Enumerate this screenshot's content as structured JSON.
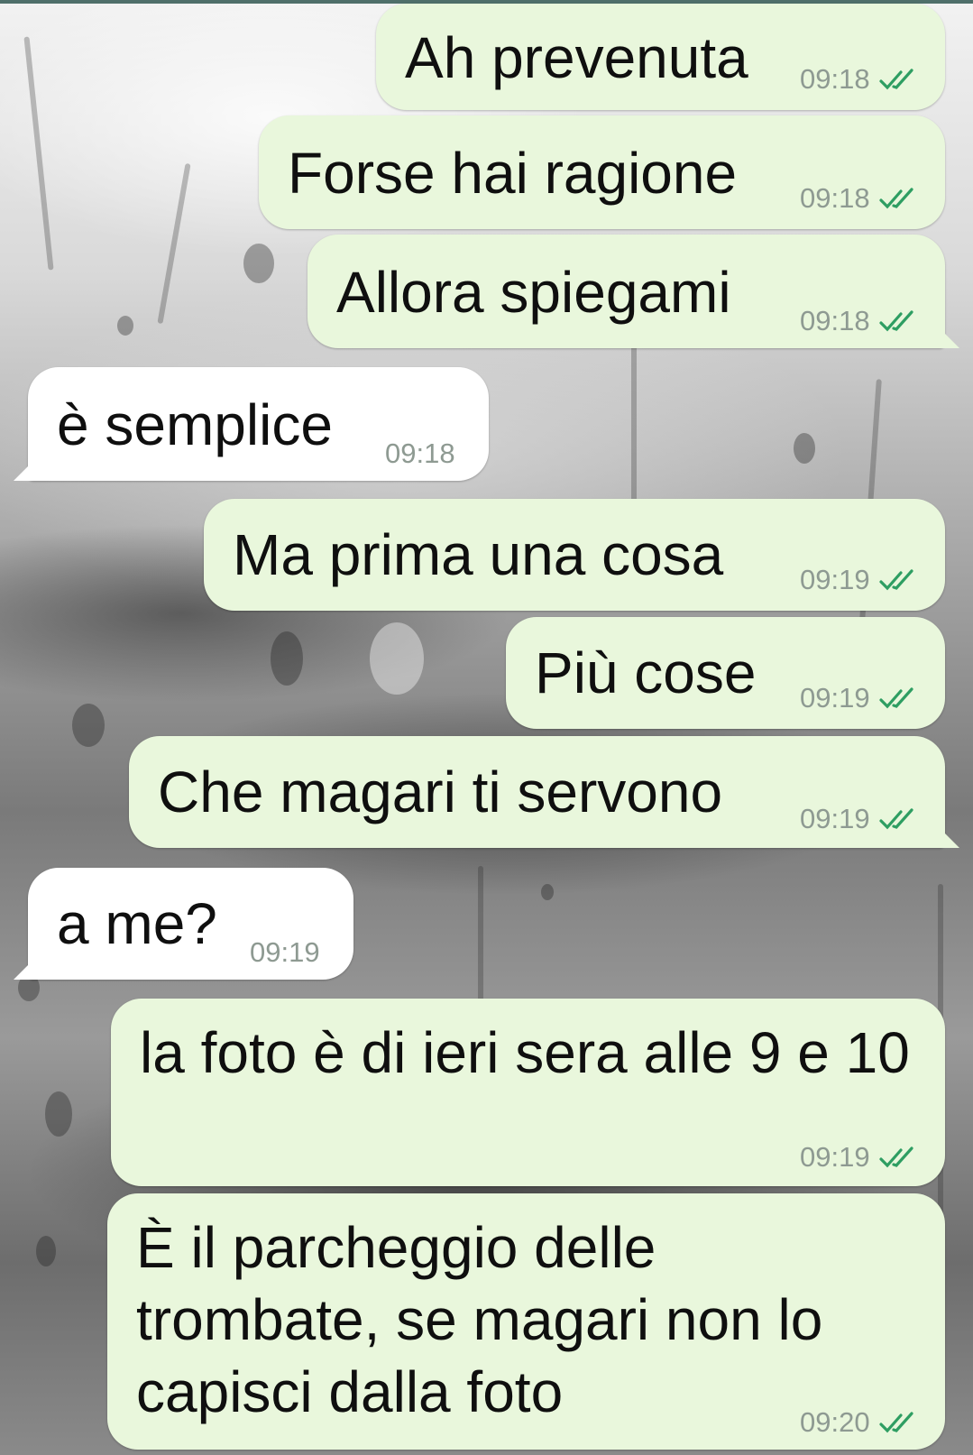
{
  "colors": {
    "outgoing_bubble": "#e9f7dc",
    "incoming_bubble": "#ffffff",
    "read_ticks": "#2e9e62",
    "timestamp": "#8e9a92"
  },
  "icons": {
    "read_receipt": "double-check-icon"
  },
  "messages": [
    {
      "direction": "outgoing",
      "text": "Ah prevenuta",
      "time": "09:18",
      "status": "read"
    },
    {
      "direction": "outgoing",
      "text": "Forse hai ragione",
      "time": "09:18",
      "status": "read"
    },
    {
      "direction": "outgoing",
      "text": "Allora spiegami",
      "time": "09:18",
      "status": "read"
    },
    {
      "direction": "incoming",
      "text": "è semplice",
      "time": "09:18"
    },
    {
      "direction": "outgoing",
      "text": "Ma prima una cosa",
      "time": "09:19",
      "status": "read"
    },
    {
      "direction": "outgoing",
      "text": "Più cose",
      "time": "09:19",
      "status": "read"
    },
    {
      "direction": "outgoing",
      "text": "Che magari ti servono",
      "time": "09:19",
      "status": "read"
    },
    {
      "direction": "incoming",
      "text": "a me?",
      "time": "09:19"
    },
    {
      "direction": "outgoing",
      "text": "la foto è di ieri sera alle 9 e 10",
      "time": "09:19",
      "status": "read"
    },
    {
      "direction": "outgoing",
      "text": "È il parcheggio delle trombate, se magari non lo capisci dalla foto",
      "time": "09:20",
      "status": "read"
    }
  ]
}
